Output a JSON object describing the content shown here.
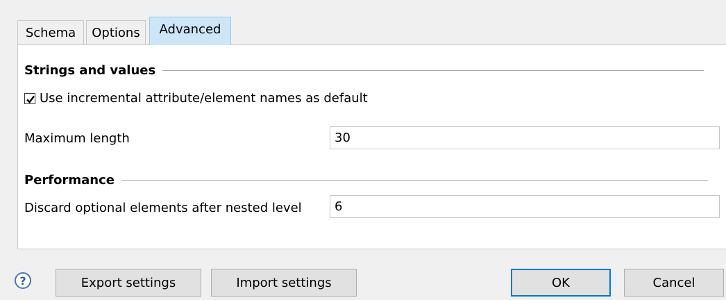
{
  "tabs": [
    {
      "label": "Schema",
      "selected": false
    },
    {
      "label": "Options",
      "selected": false
    },
    {
      "label": "Advanced",
      "selected": true
    }
  ],
  "sections": {
    "strings": {
      "title": "Strings and values",
      "checkbox_label": "Use incremental attribute/element names as default",
      "checkbox_checked": true,
      "max_length_label": "Maximum length",
      "max_length_value": "30"
    },
    "performance": {
      "title": "Performance",
      "discard_label": "Discard optional elements after nested level",
      "discard_value": "6"
    }
  },
  "footer": {
    "help_glyph": "?",
    "export_label": "Export settings",
    "import_label": "Import settings",
    "ok_label": "OK",
    "cancel_label": "Cancel"
  },
  "colors": {
    "selected_tab": "#cde6f7",
    "default_button_border": "#0078d7",
    "help_icon": "#2f5ea3"
  }
}
